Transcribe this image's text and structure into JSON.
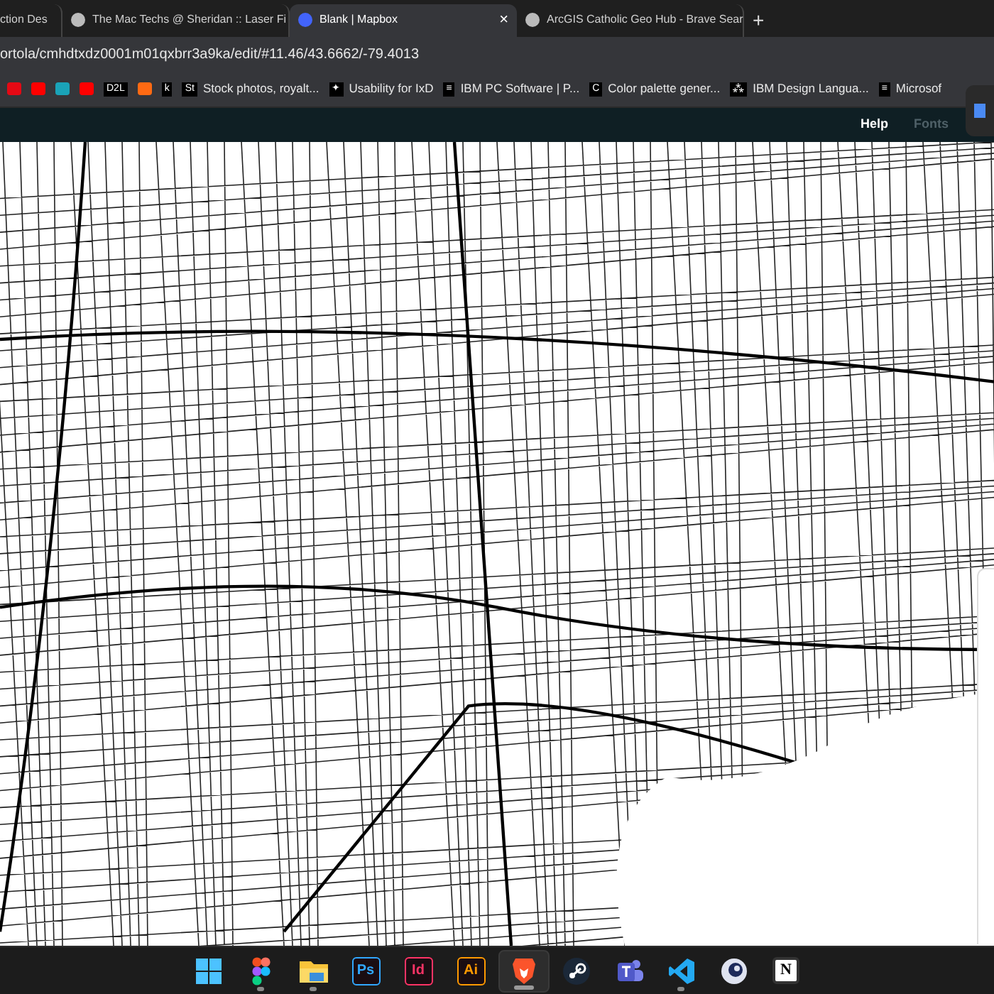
{
  "tabs": [
    {
      "title": "ction Des",
      "selected": false
    },
    {
      "title": "The Mac Techs @ Sheridan :: Laser Fi",
      "selected": false
    },
    {
      "title": "Blank | Mapbox",
      "selected": true
    },
    {
      "title": "ArcGIS Catholic Geo Hub - Brave Sear",
      "selected": false
    }
  ],
  "new_tab": "+",
  "close_tab": "×",
  "url": "ortola/cmhdtxdz0001m01qxbrr3a9ka/edit/#11.46/43.6662/-79.4013",
  "bookmarks": [
    {
      "kind": "icon",
      "color": "#e50914"
    },
    {
      "kind": "icon",
      "color": "#ff0000"
    },
    {
      "kind": "icon",
      "color": "#1aa3b8"
    },
    {
      "kind": "icon",
      "color": "#ff0000"
    },
    {
      "kind": "text",
      "icon_label": "D2L"
    },
    {
      "kind": "icon",
      "color": "#ff6a13"
    },
    {
      "kind": "text",
      "icon_label": "k"
    },
    {
      "kind": "text",
      "icon_label": "St",
      "label": "Stock photos, royalt..."
    },
    {
      "kind": "text",
      "icon_label": "✦",
      "label": "Usability for IxD"
    },
    {
      "kind": "text",
      "icon_label": "≡",
      "label": "IBM PC Software | P..."
    },
    {
      "kind": "text",
      "icon_label": "C",
      "label": "Color palette gener..."
    },
    {
      "kind": "text",
      "icon_label": "⁂",
      "label": "IBM Design Langua..."
    },
    {
      "kind": "text",
      "icon_label": "≡",
      "label": "Microsof"
    }
  ],
  "header": {
    "links": [
      {
        "label": "Help",
        "disabled": false
      },
      {
        "label": "Fonts",
        "disabled": true
      }
    ]
  },
  "taskbar": [
    {
      "kind": "start",
      "running": false,
      "selected": false
    },
    {
      "kind": "figma",
      "running": true,
      "selected": false
    },
    {
      "kind": "folder",
      "running": true,
      "selected": false
    },
    {
      "kind": "app",
      "label": "Ps",
      "color": "#31a8ff",
      "running": false,
      "selected": false
    },
    {
      "kind": "app",
      "label": "Id",
      "color": "#ff3366",
      "running": false,
      "selected": false
    },
    {
      "kind": "app",
      "label": "Ai",
      "color": "#ff9a00",
      "running": false,
      "selected": false
    },
    {
      "kind": "brave",
      "running": true,
      "selected": true
    },
    {
      "kind": "steam",
      "running": false,
      "selected": false
    },
    {
      "kind": "teams",
      "running": false,
      "selected": false
    },
    {
      "kind": "vscode",
      "running": true,
      "selected": false
    },
    {
      "kind": "cinema",
      "running": false,
      "selected": false
    },
    {
      "kind": "notion",
      "label": "N",
      "running": false,
      "selected": false
    }
  ]
}
